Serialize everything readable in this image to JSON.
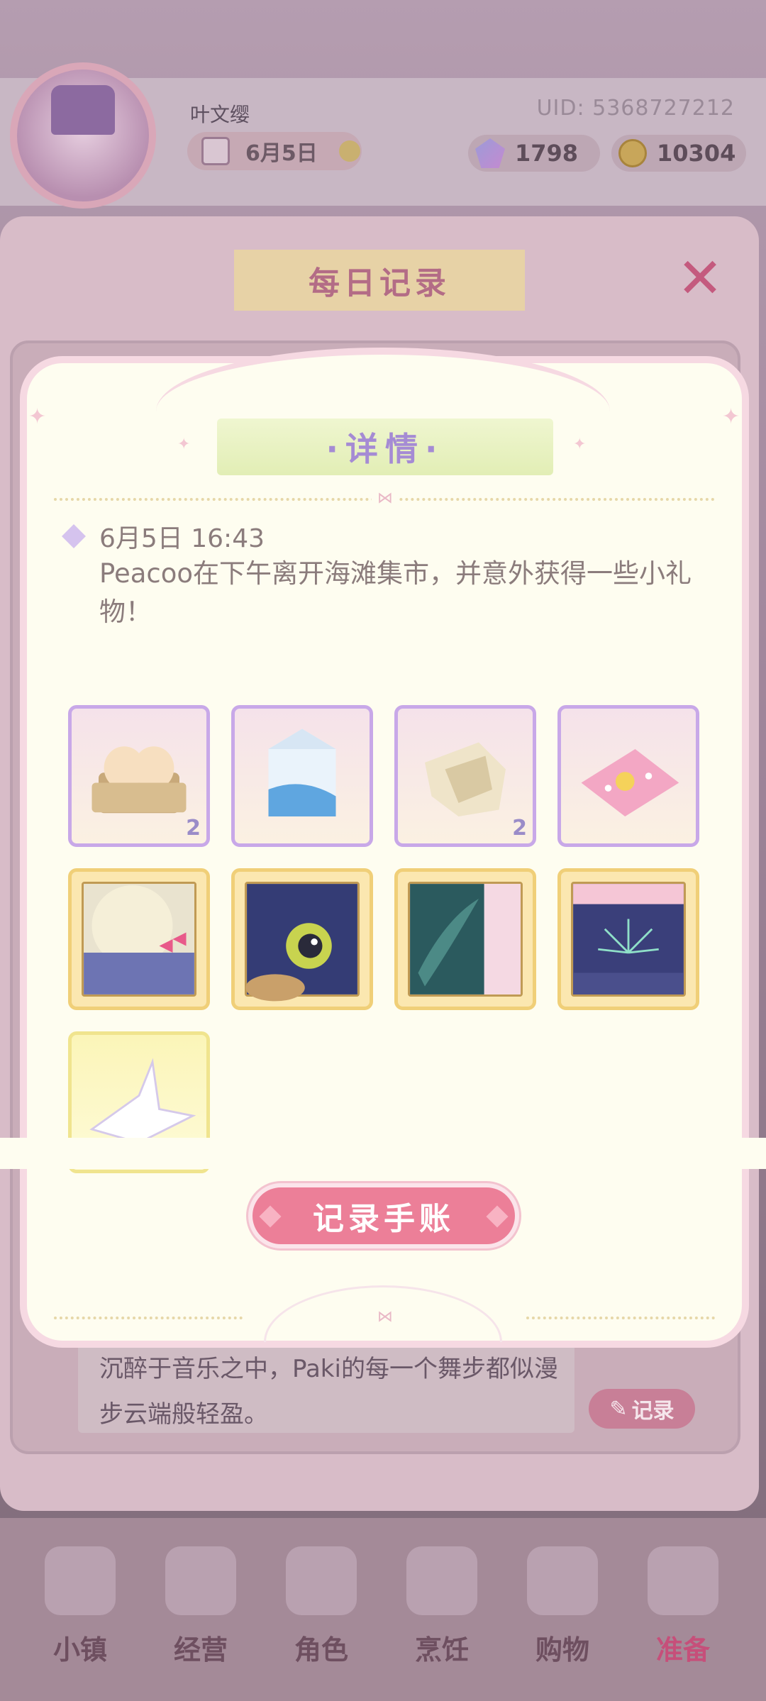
{
  "header": {
    "username": "叶文缨",
    "uid": "UID: 5368727212",
    "date": "6月5日",
    "gems": "1798",
    "coins": "10304"
  },
  "panel": {
    "title": "每日记录",
    "background_entry_text": "沉醉于音乐之中，Paki的每一个舞步都似漫步云端般轻盈。",
    "background_record_label": "记录"
  },
  "modal": {
    "title": "·详情·",
    "timestamp": "6月5日 16:43",
    "description": "Peacoo在下午离开海滩集市，并意外获得一些小礼物！",
    "items": [
      {
        "icon": "eggs-icon",
        "count": "2",
        "frame": "purple"
      },
      {
        "icon": "milk-carton-icon",
        "count": "",
        "frame": "purple"
      },
      {
        "icon": "cloth-scrap-icon",
        "count": "2",
        "frame": "purple"
      },
      {
        "icon": "pink-cushion-icon",
        "count": "",
        "frame": "purple"
      },
      {
        "icon": "moon-ribbon-card-icon",
        "count": "",
        "frame": "gold"
      },
      {
        "icon": "eye-creature-card-icon",
        "count": "",
        "frame": "gold"
      },
      {
        "icon": "leaf-curtain-card-icon",
        "count": "",
        "frame": "gold"
      },
      {
        "icon": "fireworks-card-icon",
        "count": "",
        "frame": "gold"
      },
      {
        "icon": "paper-crane-icon",
        "count": "",
        "frame": "yellow"
      }
    ],
    "record_button": "记录手账"
  },
  "nav": [
    {
      "label": "小镇",
      "active": false
    },
    {
      "label": "经营",
      "active": false
    },
    {
      "label": "角色",
      "active": false
    },
    {
      "label": "烹饪",
      "active": false
    },
    {
      "label": "购物",
      "active": false
    },
    {
      "label": "准备",
      "active": true
    }
  ],
  "colors": {
    "accent_pink": "#ec7f98",
    "title_purple": "#a58bd4",
    "modal_bg": "#fefdf0",
    "text_gray": "#8b7c7c"
  }
}
